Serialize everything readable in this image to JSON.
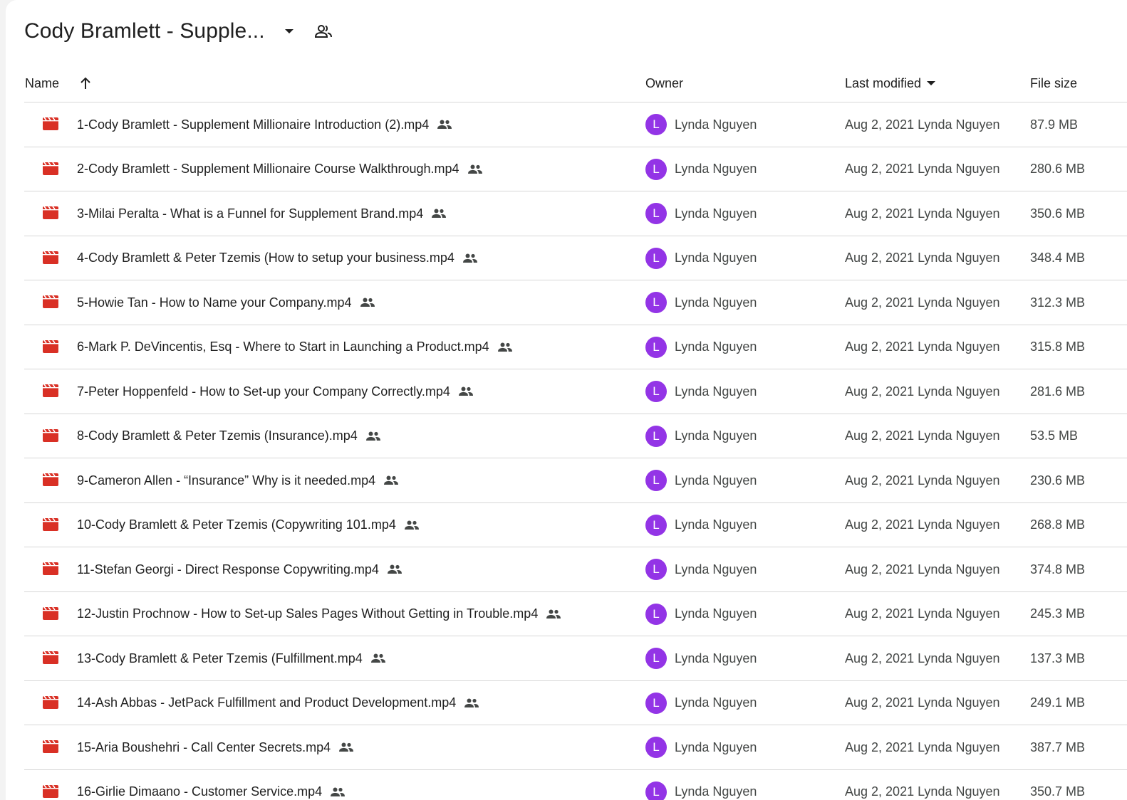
{
  "folder": {
    "title": "Cody Bramlett - Supple...",
    "title_icons": [
      "chevron-down-icon",
      "shared-people-icon"
    ]
  },
  "columns": {
    "name": "Name",
    "name_sort_icon": "arrow-up-icon",
    "owner": "Owner",
    "last_modified": "Last modified",
    "last_modified_sort_icon": "caret-down-icon",
    "file_size": "File size"
  },
  "colors": {
    "video_icon": "#d93025",
    "avatar": "#9334e6"
  },
  "files": [
    {
      "name": "1-Cody Bramlett - Supplement Millionaire Introduction (2).mp4",
      "owner_initial": "L",
      "owner": "Lynda Nguyen",
      "modified": "Aug 2, 2021 Lynda Nguyen",
      "size": "87.9 MB"
    },
    {
      "name": "2-Cody Bramlett - Supplement Millionaire Course Walkthrough.mp4",
      "owner_initial": "L",
      "owner": "Lynda Nguyen",
      "modified": "Aug 2, 2021 Lynda Nguyen",
      "size": "280.6 MB"
    },
    {
      "name": "3-Milai Peralta - What is a Funnel for Supplement Brand.mp4",
      "owner_initial": "L",
      "owner": "Lynda Nguyen",
      "modified": "Aug 2, 2021 Lynda Nguyen",
      "size": "350.6 MB"
    },
    {
      "name": "4-Cody Bramlett & Peter Tzemis (How to setup your business.mp4",
      "owner_initial": "L",
      "owner": "Lynda Nguyen",
      "modified": "Aug 2, 2021 Lynda Nguyen",
      "size": "348.4 MB"
    },
    {
      "name": "5-Howie Tan - How to Name your Company.mp4",
      "owner_initial": "L",
      "owner": "Lynda Nguyen",
      "modified": "Aug 2, 2021 Lynda Nguyen",
      "size": "312.3 MB"
    },
    {
      "name": "6-Mark P. DeVincentis, Esq - Where to Start in Launching a Product.mp4",
      "owner_initial": "L",
      "owner": "Lynda Nguyen",
      "modified": "Aug 2, 2021 Lynda Nguyen",
      "size": "315.8 MB"
    },
    {
      "name": "7-Peter Hoppenfeld - How to Set-up your Company Correctly.mp4",
      "owner_initial": "L",
      "owner": "Lynda Nguyen",
      "modified": "Aug 2, 2021 Lynda Nguyen",
      "size": "281.6 MB"
    },
    {
      "name": "8-Cody Bramlett & Peter Tzemis (Insurance).mp4",
      "owner_initial": "L",
      "owner": "Lynda Nguyen",
      "modified": "Aug 2, 2021 Lynda Nguyen",
      "size": "53.5 MB"
    },
    {
      "name": "9-Cameron Allen - “Insurance” Why is it needed.mp4",
      "owner_initial": "L",
      "owner": "Lynda Nguyen",
      "modified": "Aug 2, 2021 Lynda Nguyen",
      "size": "230.6 MB"
    },
    {
      "name": "10-Cody Bramlett & Peter Tzemis (Copywriting 101.mp4",
      "owner_initial": "L",
      "owner": "Lynda Nguyen",
      "modified": "Aug 2, 2021 Lynda Nguyen",
      "size": "268.8 MB"
    },
    {
      "name": "11-Stefan Georgi - Direct Response Copywriting.mp4",
      "owner_initial": "L",
      "owner": "Lynda Nguyen",
      "modified": "Aug 2, 2021 Lynda Nguyen",
      "size": "374.8 MB"
    },
    {
      "name": "12-Justin Prochnow - How to Set-up Sales Pages Without Getting in Trouble.mp4",
      "owner_initial": "L",
      "owner": "Lynda Nguyen",
      "modified": "Aug 2, 2021 Lynda Nguyen",
      "size": "245.3 MB"
    },
    {
      "name": "13-Cody Bramlett & Peter Tzemis (Fulfillment.mp4",
      "owner_initial": "L",
      "owner": "Lynda Nguyen",
      "modified": "Aug 2, 2021 Lynda Nguyen",
      "size": "137.3 MB"
    },
    {
      "name": "14-Ash Abbas - JetPack Fulfillment and Product Development.mp4",
      "owner_initial": "L",
      "owner": "Lynda Nguyen",
      "modified": "Aug 2, 2021 Lynda Nguyen",
      "size": "249.1 MB"
    },
    {
      "name": "15-Aria Boushehri - Call Center Secrets.mp4",
      "owner_initial": "L",
      "owner": "Lynda Nguyen",
      "modified": "Aug 2, 2021 Lynda Nguyen",
      "size": "387.7 MB"
    },
    {
      "name": "16-Girlie Dimaano - Customer Service.mp4",
      "owner_initial": "L",
      "owner": "Lynda Nguyen",
      "modified": "Aug 2, 2021 Lynda Nguyen",
      "size": "350.7 MB"
    }
  ]
}
